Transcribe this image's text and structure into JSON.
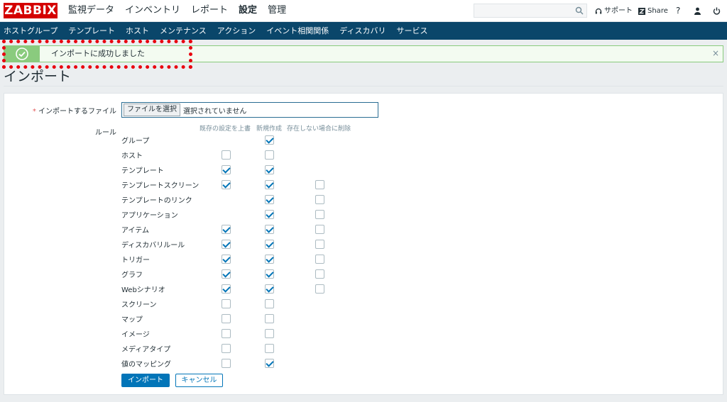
{
  "brand": {
    "logo": "ZABBIX",
    "color": "#d40000"
  },
  "main_menu": [
    {
      "label": "監視データ",
      "active": false
    },
    {
      "label": "インベントリ",
      "active": false
    },
    {
      "label": "レポート",
      "active": false
    },
    {
      "label": "設定",
      "active": true
    },
    {
      "label": "管理",
      "active": false
    }
  ],
  "search": {
    "value": "",
    "placeholder": ""
  },
  "toolbar": {
    "support": "サポート",
    "share": "Share",
    "help": "?"
  },
  "sub_menu": [
    "ホストグループ",
    "テンプレート",
    "ホスト",
    "メンテナンス",
    "アクション",
    "イベント相関関係",
    "ディスカバリ",
    "サービス"
  ],
  "message": {
    "text": "インポートに成功しました",
    "close": "×"
  },
  "page_title": "インポート",
  "form": {
    "file_label": "インポートするファイル",
    "file_button": "ファイルを選択",
    "file_status": "選択されていません",
    "rules_label": "ルール",
    "col_update": "既存の設定を上書",
    "col_create": "新規作成",
    "col_delete": "存在しない場合に削除",
    "rules": [
      {
        "name": "グループ",
        "update": null,
        "create": true,
        "delete": null
      },
      {
        "name": "ホスト",
        "update": false,
        "create": false,
        "delete": null
      },
      {
        "name": "テンプレート",
        "update": true,
        "create": true,
        "delete": null
      },
      {
        "name": "テンプレートスクリーン",
        "update": true,
        "create": true,
        "delete": false
      },
      {
        "name": "テンプレートのリンク",
        "update": null,
        "create": true,
        "delete": false
      },
      {
        "name": "アプリケーション",
        "update": null,
        "create": true,
        "delete": false
      },
      {
        "name": "アイテム",
        "update": true,
        "create": true,
        "delete": false
      },
      {
        "name": "ディスカバリルール",
        "update": true,
        "create": true,
        "delete": false
      },
      {
        "name": "トリガー",
        "update": true,
        "create": true,
        "delete": false
      },
      {
        "name": "グラフ",
        "update": true,
        "create": true,
        "delete": false
      },
      {
        "name": "Webシナリオ",
        "update": true,
        "create": true,
        "delete": false
      },
      {
        "name": "スクリーン",
        "update": false,
        "create": false,
        "delete": null
      },
      {
        "name": "マップ",
        "update": false,
        "create": false,
        "delete": null
      },
      {
        "name": "イメージ",
        "update": false,
        "create": false,
        "delete": null
      },
      {
        "name": "メディアタイプ",
        "update": false,
        "create": false,
        "delete": null
      },
      {
        "name": "値のマッピング",
        "update": false,
        "create": true,
        "delete": null
      }
    ],
    "import_button": "インポート",
    "cancel_button": "キャンセル"
  },
  "colors": {
    "accent": "#0275b8",
    "nav_bg": "#0a466a",
    "success": "#8acb7e",
    "highlight": "#e8000e"
  }
}
